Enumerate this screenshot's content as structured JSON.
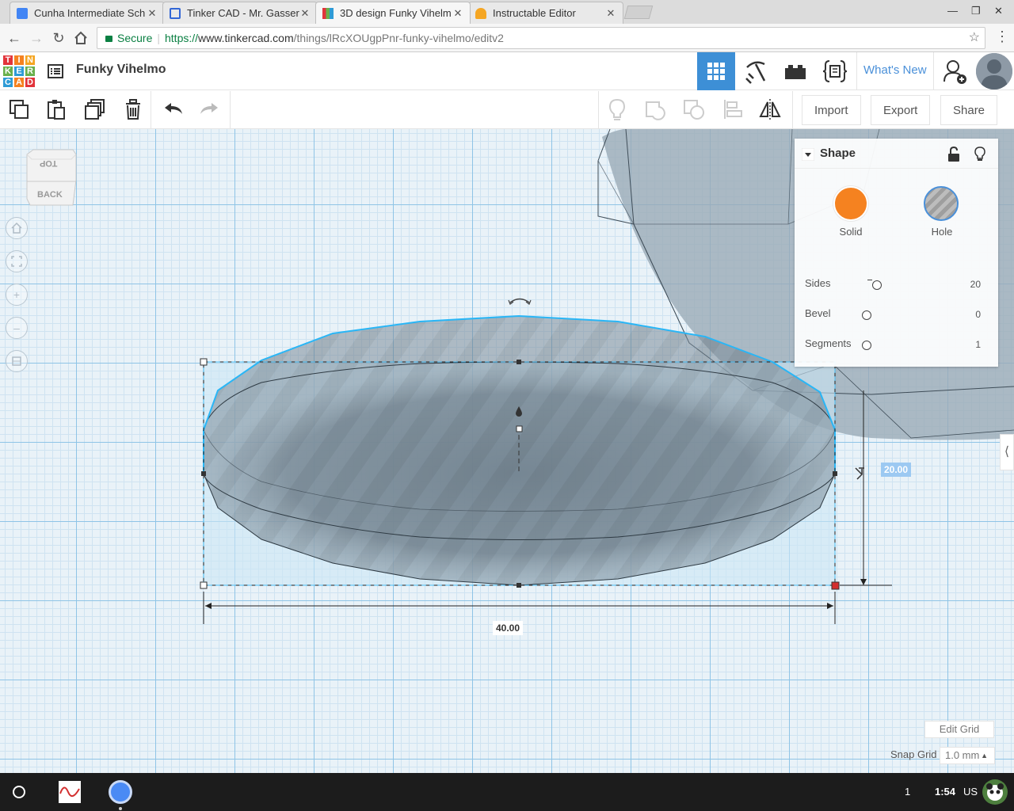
{
  "browser": {
    "tabs": [
      {
        "title": "Cunha Intermediate Sch",
        "close": "✕",
        "favicon": "doc-icon",
        "favicon_color": "#4285f4"
      },
      {
        "title": "Tinker CAD - Mr. Gasser",
        "close": "✕",
        "favicon": "sites-icon",
        "favicon_color": "#3367d6"
      },
      {
        "title": "3D design Funky Vihelm",
        "close": "✕",
        "favicon": "tinkercad-icon",
        "active": true
      },
      {
        "title": "Instructable Editor",
        "close": "✕",
        "favicon": "instructables-icon",
        "favicon_color": "#f5a623"
      }
    ],
    "address": {
      "secure_label": "Secure",
      "url_scheme": "https://",
      "url_host": "www.tinkercad.com",
      "url_path": "/things/lRcXOUgpPnr-funky-vihelmo/editv2"
    }
  },
  "header": {
    "logo_letters": [
      "TIN",
      "KER",
      "CAD"
    ],
    "logo_colors": [
      "#e2343b",
      "#f58220",
      "#f5a623",
      "#6ab04c",
      "#2e9bd6",
      "#6ab04c",
      "#2e9bd6",
      "#f58220",
      "#e2343b"
    ],
    "project_title": "Funky Vihelmo",
    "whats_new": "What's New",
    "accent": "#3d8fd6"
  },
  "toolbar": {
    "import_label": "Import",
    "export_label": "Export",
    "share_label": "Share"
  },
  "viewcube": {
    "top_label": "TOP",
    "back_label": "BACK"
  },
  "inspector": {
    "title": "Shape",
    "solid_label": "Solid",
    "hole_label": "Hole",
    "solid_color": "#f58220",
    "props": [
      {
        "label": "Sides",
        "value": "20"
      },
      {
        "label": "Bevel",
        "value": "0"
      },
      {
        "label": "Segments",
        "value": "1"
      }
    ]
  },
  "dimensions": {
    "width": "40.00",
    "height": "20.00"
  },
  "grid": {
    "edit_grid_label": "Edit Grid",
    "snap_label": "Snap Grid",
    "snap_value": "1.0 mm"
  },
  "taskbar": {
    "badge": "1",
    "time": "1:54",
    "locale": "US"
  }
}
